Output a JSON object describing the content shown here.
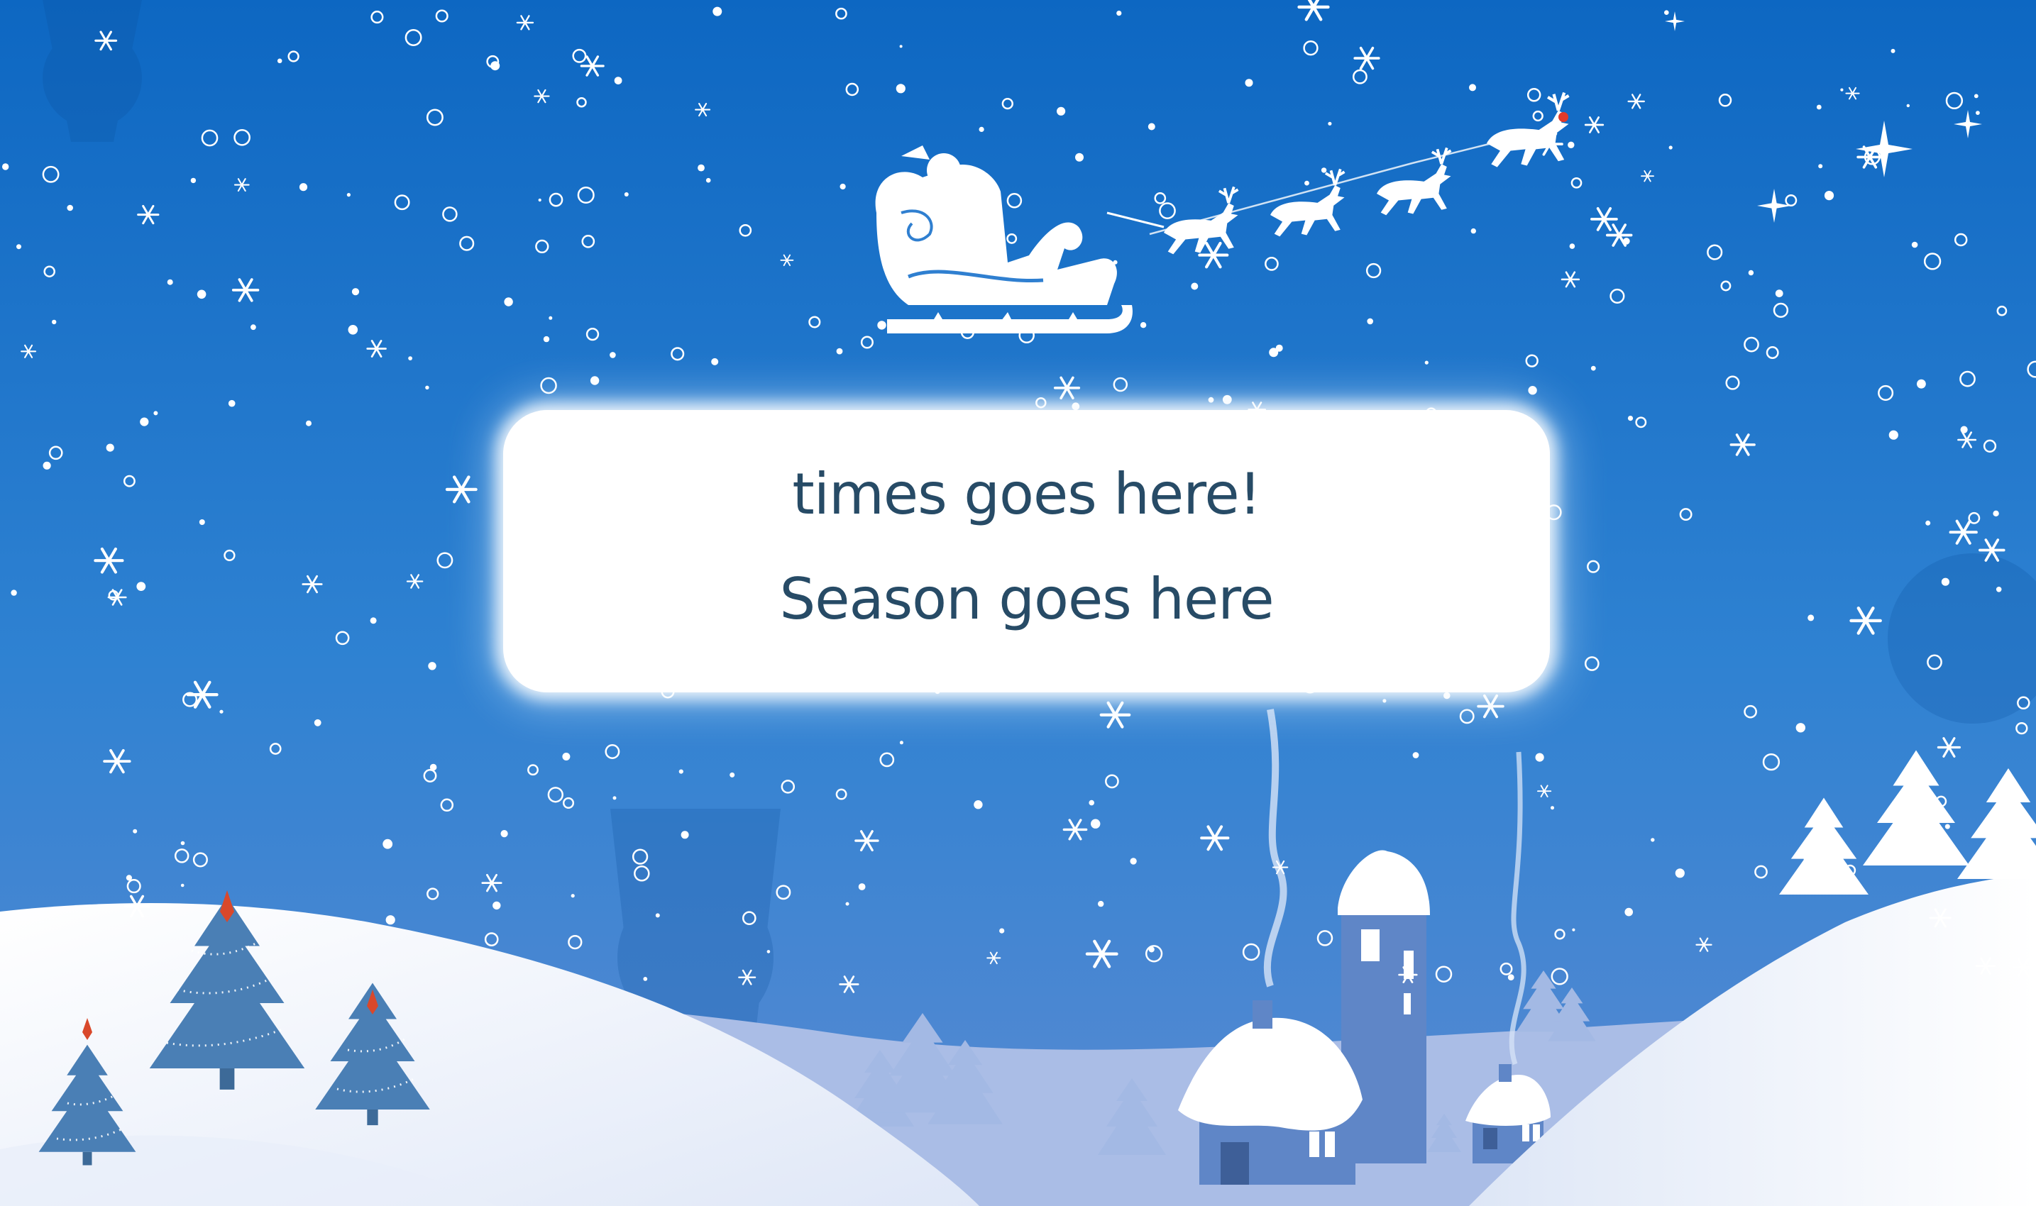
{
  "card": {
    "line1": "times goes here!",
    "line2": "Season goes here"
  },
  "colors": {
    "sky_top": "#0d67c2",
    "sky_bottom": "#5a8ad2",
    "snow": "#ffffff",
    "snow_shadow": "#c5d3ef",
    "tree_blue": "#4a7fb5",
    "house_blue": "#5f86c7",
    "text": "#274b66"
  },
  "icons": [
    "santa-sleigh-icon",
    "reindeer-icon",
    "christmas-tree-icon",
    "house-icon",
    "snowflake-icon",
    "sparkle-star-icon"
  ]
}
